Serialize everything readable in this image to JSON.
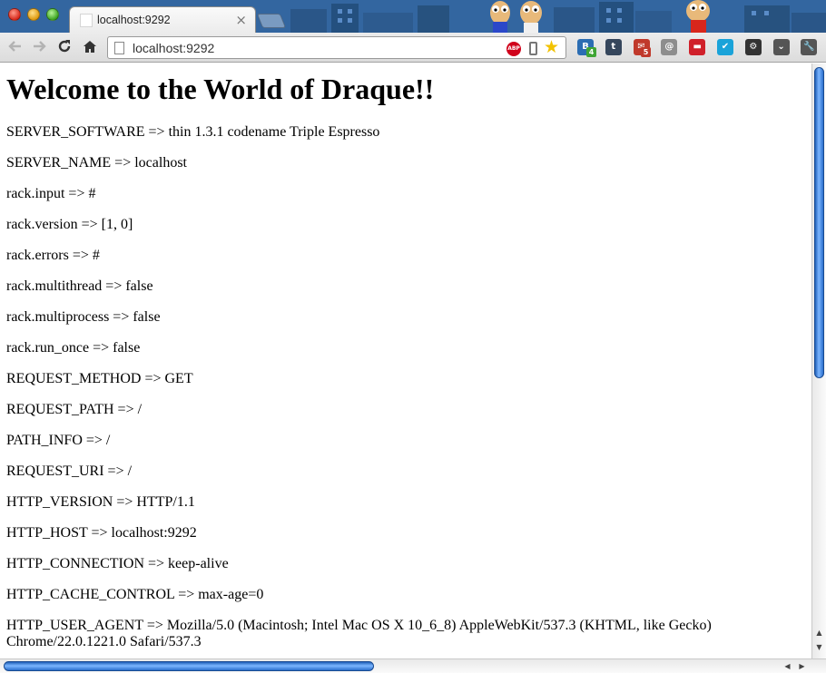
{
  "browser": {
    "tab_title": "localhost:9292",
    "tab_close_glyph": "×",
    "address": "localhost:9292",
    "abp_label": "ABP",
    "extensions": [
      {
        "name": "blog-icon",
        "label": "B",
        "color": "#2b6db3"
      },
      {
        "name": "tumblr-icon",
        "label": "t",
        "color": "#35465c"
      },
      {
        "name": "mail-icon",
        "label": "✉",
        "color": "#c0392b",
        "badge": "5"
      },
      {
        "name": "address-book-icon",
        "label": "@",
        "color": "#8d8d8d"
      },
      {
        "name": "couch-icon",
        "label": "▬",
        "color": "#d0202a"
      },
      {
        "name": "check-icon",
        "label": "✔",
        "color": "#1aa3d9"
      },
      {
        "name": "settings-icon",
        "label": "⚙",
        "color": "#333333"
      },
      {
        "name": "pocket-icon",
        "label": "⌄",
        "color": "#555555"
      },
      {
        "name": "wrench-icon",
        "label": "🔧",
        "color": "#555555"
      }
    ],
    "blog_badge": "4"
  },
  "page": {
    "heading": "Welcome to the World of Draque!!",
    "lines": [
      "SERVER_SOFTWARE => thin 1.3.1 codename Triple Espresso",
      "SERVER_NAME => localhost",
      "rack.input => #",
      "rack.version => [1, 0]",
      "rack.errors => #",
      "rack.multithread => false",
      "rack.multiprocess => false",
      "rack.run_once => false",
      "REQUEST_METHOD => GET",
      "REQUEST_PATH => /",
      "PATH_INFO => /",
      "REQUEST_URI => /",
      "HTTP_VERSION => HTTP/1.1",
      "HTTP_HOST => localhost:9292",
      "HTTP_CONNECTION => keep-alive",
      "HTTP_CACHE_CONTROL => max-age=0",
      "HTTP_USER_AGENT => Mozilla/5.0 (Macintosh; Intel Mac OS X 10_6_8) AppleWebKit/537.3 (KHTML, like Gecko) Chrome/22.0.1221.0 Safari/537.3"
    ]
  },
  "colors": {
    "tabstrip": "#2c5c92",
    "scroll_thumb": "#2b6fcc"
  },
  "scroll": {
    "vertical_fraction": 0.52,
    "horizontal_fraction": 0.45
  }
}
